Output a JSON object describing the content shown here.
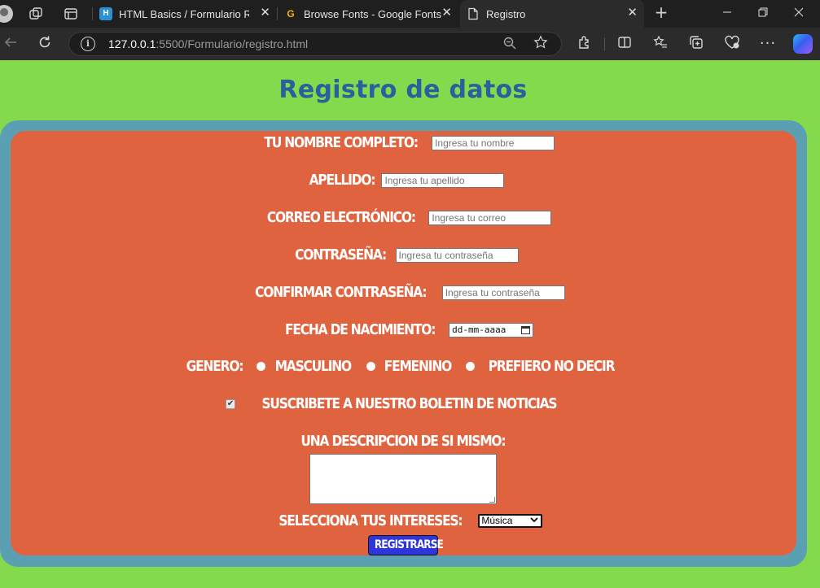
{
  "browser": {
    "tabs": [
      {
        "title": "HTML Basics / Formulario Registro",
        "active": false
      },
      {
        "title": "Browse Fonts - Google Fonts",
        "active": false
      },
      {
        "title": "Registro",
        "active": true
      }
    ],
    "url_host": "127.0.0.1",
    "url_rest": ":5500/Formulario/registro.html",
    "close_glyph": "✕",
    "new_tab_glyph": "+"
  },
  "page": {
    "title": "Registro de datos",
    "colors": {
      "background": "#84d94c",
      "outer": "#5b9fb3",
      "card": "#e06340",
      "title": "#2b5f9e",
      "button": "#2f36d9"
    },
    "form": {
      "fields": [
        {
          "label": "Tu nombre completo:",
          "placeholder": "Ingresa tu nombre"
        },
        {
          "label": "Apellido:",
          "placeholder": "Ingresa tu apellido"
        },
        {
          "label": "Correo electrónico:",
          "placeholder": "Ingresa tu correo"
        },
        {
          "label": "Contraseña:",
          "placeholder": "Ingresa tu contraseña"
        },
        {
          "label": "Confirmar contraseña:",
          "placeholder": "Ingresa tu contraseña"
        }
      ],
      "birthdate": {
        "label": "Fecha de nacimiento:",
        "placeholder": "dd-mm-aaaa"
      },
      "gender": {
        "label": "Genero:",
        "options": [
          "Masculino",
          "Femenino",
          "Prefiero no decir"
        ]
      },
      "newsletter": {
        "label": "Suscribete a nuestro boletin de noticias",
        "checked": true,
        "check_glyph": "✔"
      },
      "description": {
        "label": "Una descripcion de si mismo:"
      },
      "interests": {
        "label": "Selecciona tus intereses:",
        "selected": "Música"
      },
      "submit_label": "Registrarse"
    }
  }
}
